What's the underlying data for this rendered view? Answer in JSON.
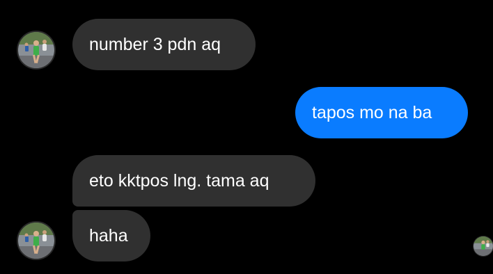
{
  "messages": [
    {
      "sender": "other",
      "text": "number 3 pdn aq"
    },
    {
      "sender": "me",
      "text": "tapos mo na ba"
    },
    {
      "sender": "other",
      "text": "eto kktpos lng. tama aq"
    },
    {
      "sender": "other",
      "text": "haha"
    }
  ],
  "colors": {
    "background": "#000000",
    "incoming_bubble": "#303030",
    "outgoing_bubble": "#0a7cff",
    "text": "#ffffff"
  },
  "icons": {
    "contact_avatar": "runner-photo-avatar",
    "read_receipt": "runner-photo-read-receipt"
  }
}
